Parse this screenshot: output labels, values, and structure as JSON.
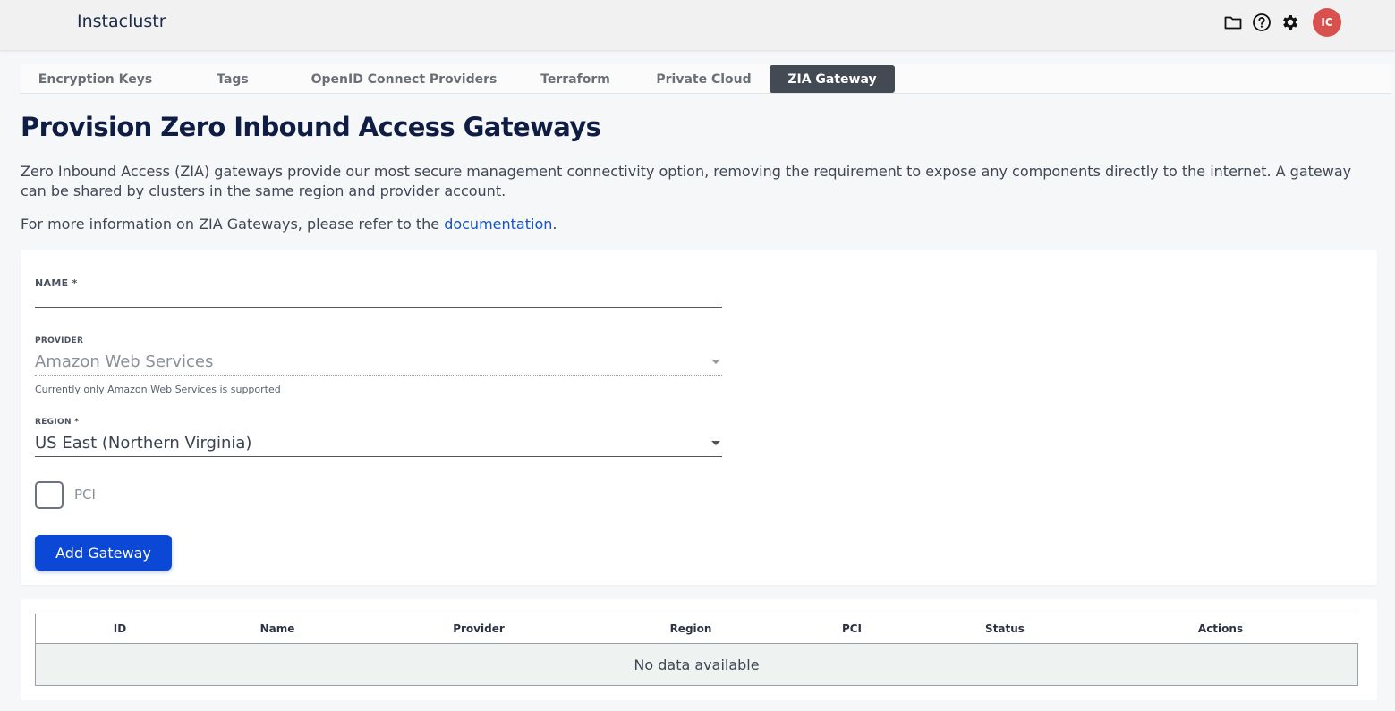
{
  "app": {
    "brand": "Instaclustr",
    "avatar_initials": "IC"
  },
  "header_icons": [
    "folder-icon",
    "help-icon",
    "gear-icon"
  ],
  "tabs": [
    {
      "label": "Encryption Keys",
      "active": false
    },
    {
      "label": "Tags",
      "active": false
    },
    {
      "label": "OpenID Connect Providers",
      "active": false
    },
    {
      "label": "Terraform",
      "active": false
    },
    {
      "label": "Private Cloud",
      "active": false
    },
    {
      "label": "ZIA Gateway",
      "active": true
    }
  ],
  "page": {
    "title": "Provision Zero Inbound Access Gateways",
    "description": "Zero Inbound Access (ZIA) gateways provide our most secure management connectivity option, removing the requirement to expose any components directly to the internet. A gateway can be shared by clusters in the same region and provider account.",
    "more_info_prefix": "For more information on ZIA Gateways, please refer to the ",
    "more_info_link": "documentation",
    "more_info_suffix": "."
  },
  "form": {
    "name_label": "NAME *",
    "name_value": "",
    "provider_label": "PROVIDER",
    "provider_value": "Amazon Web Services",
    "provider_hint": "Currently only Amazon Web Services is supported",
    "region_label": "REGION *",
    "region_value": "US East (Northern Virginia)",
    "pci_label": "PCI",
    "pci_checked": false,
    "submit_label": "Add Gateway"
  },
  "table": {
    "columns": [
      "ID",
      "Name",
      "Provider",
      "Region",
      "PCI",
      "Status",
      "Actions"
    ],
    "empty_text": "No data available"
  },
  "colors": {
    "primary": "#0b48d6",
    "active_tab": "#434a54",
    "avatar": "#d9514e",
    "link": "#1552c5"
  }
}
